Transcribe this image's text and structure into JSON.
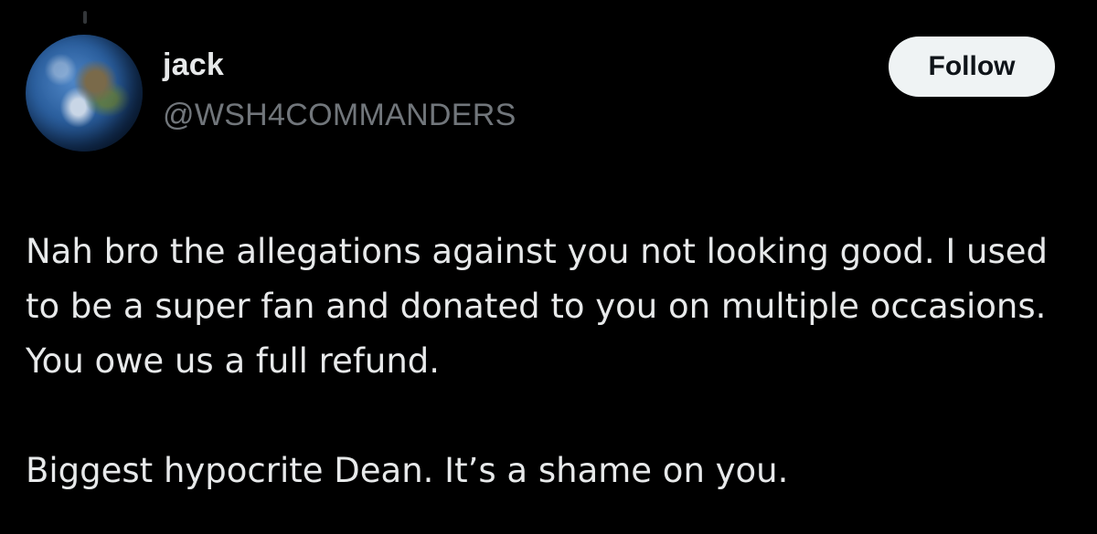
{
  "tweet": {
    "author": {
      "display_name": "jack",
      "handle": "@WSH4COMMANDERS",
      "avatar_icon": "earth-globe-avatar"
    },
    "follow_label": "Follow",
    "paragraphs": [
      "Nah bro the allegations against you not looking good. I used to be a super fan and donated to you on multiple occasions. You owe us a full refund.",
      "Biggest hypocrite Dean. It’s a shame on you."
    ]
  },
  "colors": {
    "background": "#000000",
    "primary_text": "#e7e9ea",
    "secondary_text": "#71767b",
    "button_bg": "#eff3f4",
    "button_text": "#0f1419"
  }
}
